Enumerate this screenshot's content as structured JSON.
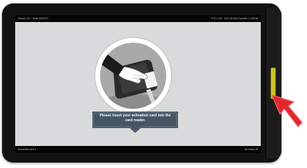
{
  "status_top": {
    "left": "Device: 'D1' · Build 2003372",
    "right": "PTC: C22 · 6011:91:001 Founder: 0:123:96"
  },
  "status_bottom": {
    "left": "Subscribe card 3",
    "right": "Ver ready 28"
  },
  "prompt": {
    "message": "Please insert your activation card into the card reader."
  },
  "colors": {
    "screen_bg": "#d9dadb",
    "banner": "#465564",
    "slot": "#c9c427",
    "arrow": "#e0282e"
  },
  "icons": [
    "card-insert-illustration",
    "red-arrow-pointer"
  ]
}
